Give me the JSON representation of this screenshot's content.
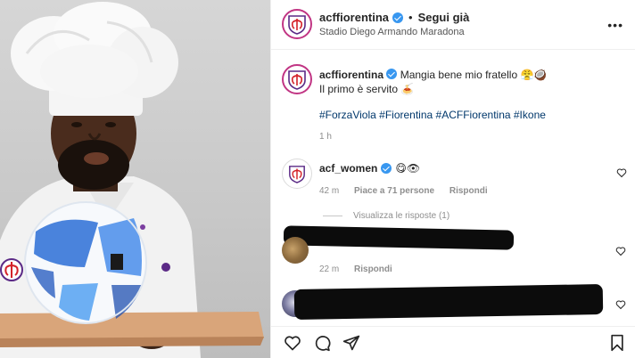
{
  "post": {
    "username": "acffiorentina",
    "follow_status": "Segui già",
    "separator": "•",
    "location": "Stadio Diego Armando Maradona",
    "more_label": "•••"
  },
  "caption": {
    "username": "acffiorentina",
    "line1": "Mangia bene mio fratello 😤🥥",
    "line2": "Il primo è servito 🍝",
    "hashtags": "#ForzaViola #Fiorentina #ACFFiorentina #Ikone",
    "time": "1 h"
  },
  "comments": [
    {
      "username": "acf_women",
      "text": "😋👁",
      "time": "42 m",
      "likes": "Piace a 71 persone",
      "reply_label": "Rispondi",
      "view_replies": "Visualizza le risposte (1)"
    },
    {
      "time": "22 m",
      "reply_label": "Rispondi"
    },
    {}
  ],
  "icons": {
    "like": "heart-icon",
    "comment": "comment-icon",
    "share": "share-icon",
    "save": "bookmark-icon",
    "verified": "verified-badge-icon"
  },
  "colors": {
    "verified": "#3897f0",
    "hashtag": "#00376b",
    "muted": "#8e8e8e",
    "fiorentina_purple": "#5b2a86",
    "story_ring": "#c13584"
  }
}
